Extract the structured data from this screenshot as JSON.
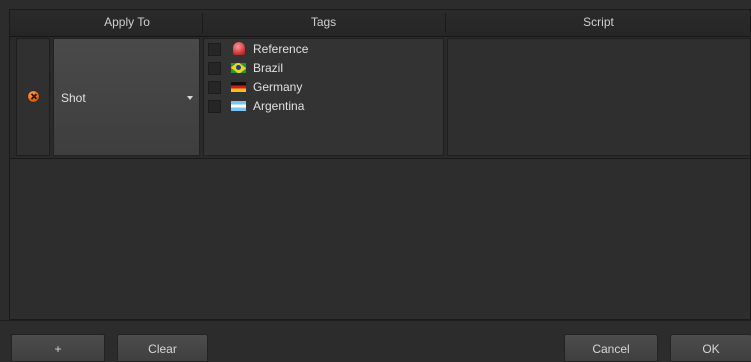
{
  "table": {
    "headers": {
      "apply_to": "Apply To",
      "tags": "Tags",
      "script": "Script"
    },
    "rows": [
      {
        "apply_to_value": "Shot",
        "tags": [
          {
            "label": "Reference",
            "icon": "reference-icon",
            "checked": false
          },
          {
            "label": "Brazil",
            "icon": "brazil-flag-icon",
            "checked": false
          },
          {
            "label": "Germany",
            "icon": "germany-flag-icon",
            "checked": false
          },
          {
            "label": "Argentina",
            "icon": "argentina-flag-icon",
            "checked": false
          }
        ],
        "script": ""
      }
    ]
  },
  "buttons": {
    "add": "+",
    "clear": "Clear",
    "cancel": "Cancel",
    "ok": "OK"
  },
  "colors": {
    "remove_icon": "#e06010",
    "background": "#2c2c2c"
  }
}
